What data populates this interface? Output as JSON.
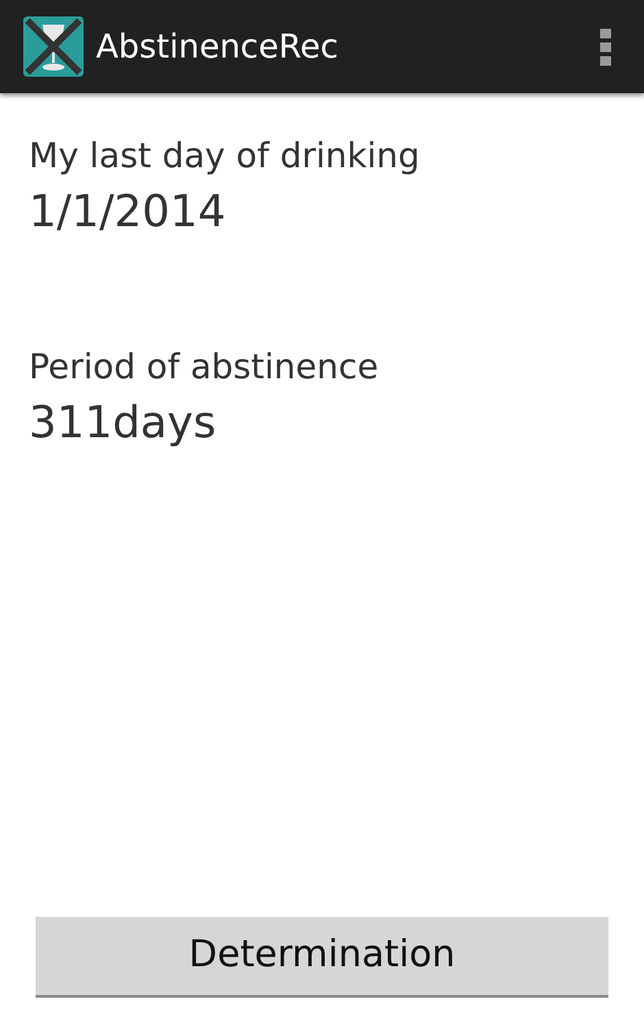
{
  "action_bar": {
    "title": "AbstinenceRec"
  },
  "fields": [
    {
      "label": "My last day of drinking",
      "value": "1/1/2014"
    },
    {
      "label": "Period of abstinence",
      "value": "311days"
    }
  ],
  "button": {
    "label": "Determination"
  }
}
